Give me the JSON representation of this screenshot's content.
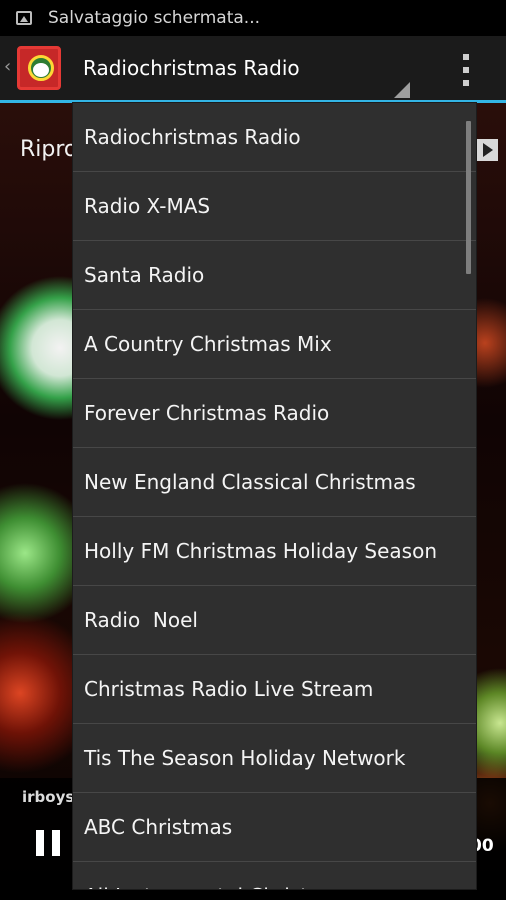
{
  "status_bar": {
    "notification_icon": "screenshot-icon",
    "text": "Salvataggio schermata..."
  },
  "action_bar": {
    "up_icon": "chevron-left-icon",
    "app_icon": "santa-radio-app-icon",
    "selected_station": "Radiochristmas Radio",
    "overflow_icon": "overflow-menu-icon",
    "accent_color": "#33b5e5"
  },
  "background": {
    "title_fragment": "Ripro",
    "play_icon": "play-icon",
    "now_playing_fragment": "irboys",
    "pause_icon": "pause-icon",
    "right_fragment": "00"
  },
  "dropdown": {
    "items": [
      {
        "label": "Radiochristmas Radio"
      },
      {
        "label": "Radio X-MAS"
      },
      {
        "label": "Santa Radio"
      },
      {
        "label": "A Country Christmas Mix"
      },
      {
        "label": "Forever Christmas Radio"
      },
      {
        "label": "New England Classical Christmas"
      },
      {
        "label": "Holly FM Christmas Holiday Season"
      },
      {
        "label": "Radio  Noel"
      },
      {
        "label": "Christmas Radio Live Stream"
      },
      {
        "label": "Tis The Season Holiday Network"
      },
      {
        "label": "ABC Christmas"
      },
      {
        "label": "All Instrumental Christmas"
      }
    ]
  }
}
